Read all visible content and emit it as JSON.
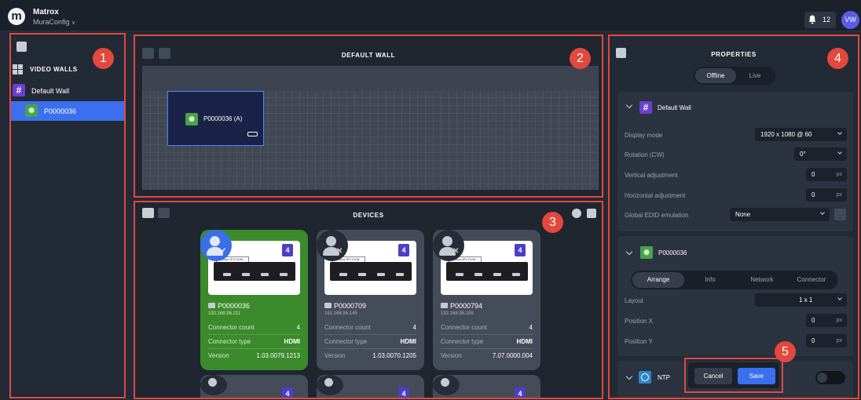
{
  "app": {
    "name": "Matrox",
    "project": "MuraConfig",
    "logo_letter": "m"
  },
  "topbar": {
    "notification_count": "12",
    "user_initials": "VW"
  },
  "callouts": [
    "1",
    "2",
    "3",
    "4",
    "5"
  ],
  "sidebar": {
    "section_label": "VIDEO WALLS",
    "wall_name": "Default Wall",
    "device_name": "P0000036"
  },
  "wall": {
    "title": "DEFAULT WALL",
    "screen_label": "P0000036 (A)"
  },
  "devices": {
    "title": "DEVICES",
    "count_field_label": "Connector count",
    "type_field_label": "Connector type",
    "version_field_label": "Version",
    "photo_tag": "Mura IPX DVW",
    "items": [
      {
        "name": "P0000036",
        "ip": "192.168.96.211",
        "connector_count": "4",
        "connector_type": "HDMI",
        "version": "1.03.0079.1213",
        "badge": "4",
        "status_mark": "✓"
      },
      {
        "name": "P0000709",
        "ip": "192.168.96.145",
        "connector_count": "4",
        "connector_type": "HDMI",
        "version": "1.03.0070.1205",
        "badge": "4",
        "status_mark": "✕"
      },
      {
        "name": "P0000794",
        "ip": "192.168.96.206",
        "connector_count": "4",
        "connector_type": "HDMI",
        "version": "7.07.0000.004",
        "badge": "4",
        "status_mark": "✕"
      }
    ],
    "more_badges": [
      "4",
      "4",
      "4"
    ]
  },
  "properties": {
    "title": "PROPERTIES",
    "mode_tabs": [
      "Offline",
      "Live"
    ],
    "wall_section": {
      "title": "Default Wall",
      "display_mode_label": "Display mode",
      "display_mode_value": "1920 x 1080 @ 60",
      "rotation_label": "Rotation (CW)",
      "rotation_value": "0°",
      "vertical_label": "Vertical adjustment",
      "vertical_value": "0",
      "horizontal_label": "Horizontal adjustment",
      "horizontal_value": "0",
      "edid_label": "Global EDID emulation",
      "edid_value": "None",
      "unit": "px"
    },
    "device_section": {
      "title": "P0000036",
      "tabs": [
        "Arrange",
        "Info",
        "Network",
        "Connector"
      ],
      "layout_label": "Layout",
      "layout_value": "1 x 1",
      "posx_label": "Position X",
      "posx_value": "0",
      "posy_label": "Position Y",
      "posy_value": "0",
      "unit": "px"
    },
    "ntp_section": {
      "title": "NTP"
    },
    "actions": {
      "cancel": "Cancel",
      "save": "Save"
    }
  },
  "colors": {
    "accent": "#3b6ff0",
    "callout": "#e2483d",
    "selected_card": "#3b8a2c",
    "wall_icon": "#6a3fcf",
    "device_icon": "#46a34c"
  }
}
